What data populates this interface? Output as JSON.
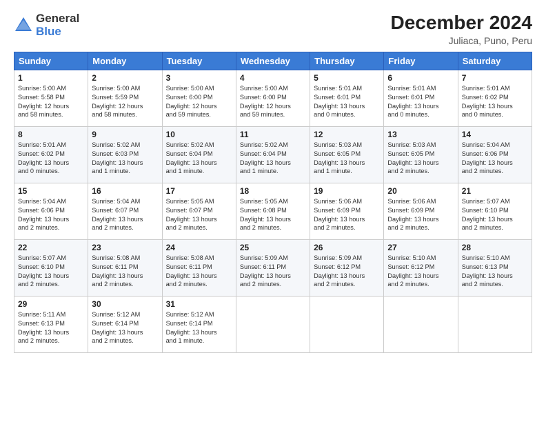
{
  "logo": {
    "general": "General",
    "blue": "Blue"
  },
  "title": "December 2024",
  "location": "Juliaca, Puno, Peru",
  "days_of_week": [
    "Sunday",
    "Monday",
    "Tuesday",
    "Wednesday",
    "Thursday",
    "Friday",
    "Saturday"
  ],
  "weeks": [
    [
      {
        "day": "1",
        "info": "Sunrise: 5:00 AM\nSunset: 5:58 PM\nDaylight: 12 hours\nand 58 minutes."
      },
      {
        "day": "2",
        "info": "Sunrise: 5:00 AM\nSunset: 5:59 PM\nDaylight: 12 hours\nand 58 minutes."
      },
      {
        "day": "3",
        "info": "Sunrise: 5:00 AM\nSunset: 6:00 PM\nDaylight: 12 hours\nand 59 minutes."
      },
      {
        "day": "4",
        "info": "Sunrise: 5:00 AM\nSunset: 6:00 PM\nDaylight: 12 hours\nand 59 minutes."
      },
      {
        "day": "5",
        "info": "Sunrise: 5:01 AM\nSunset: 6:01 PM\nDaylight: 13 hours\nand 0 minutes."
      },
      {
        "day": "6",
        "info": "Sunrise: 5:01 AM\nSunset: 6:01 PM\nDaylight: 13 hours\nand 0 minutes."
      },
      {
        "day": "7",
        "info": "Sunrise: 5:01 AM\nSunset: 6:02 PM\nDaylight: 13 hours\nand 0 minutes."
      }
    ],
    [
      {
        "day": "8",
        "info": "Sunrise: 5:01 AM\nSunset: 6:02 PM\nDaylight: 13 hours\nand 0 minutes."
      },
      {
        "day": "9",
        "info": "Sunrise: 5:02 AM\nSunset: 6:03 PM\nDaylight: 13 hours\nand 1 minute."
      },
      {
        "day": "10",
        "info": "Sunrise: 5:02 AM\nSunset: 6:04 PM\nDaylight: 13 hours\nand 1 minute."
      },
      {
        "day": "11",
        "info": "Sunrise: 5:02 AM\nSunset: 6:04 PM\nDaylight: 13 hours\nand 1 minute."
      },
      {
        "day": "12",
        "info": "Sunrise: 5:03 AM\nSunset: 6:05 PM\nDaylight: 13 hours\nand 1 minute."
      },
      {
        "day": "13",
        "info": "Sunrise: 5:03 AM\nSunset: 6:05 PM\nDaylight: 13 hours\nand 2 minutes."
      },
      {
        "day": "14",
        "info": "Sunrise: 5:04 AM\nSunset: 6:06 PM\nDaylight: 13 hours\nand 2 minutes."
      }
    ],
    [
      {
        "day": "15",
        "info": "Sunrise: 5:04 AM\nSunset: 6:06 PM\nDaylight: 13 hours\nand 2 minutes."
      },
      {
        "day": "16",
        "info": "Sunrise: 5:04 AM\nSunset: 6:07 PM\nDaylight: 13 hours\nand 2 minutes."
      },
      {
        "day": "17",
        "info": "Sunrise: 5:05 AM\nSunset: 6:07 PM\nDaylight: 13 hours\nand 2 minutes."
      },
      {
        "day": "18",
        "info": "Sunrise: 5:05 AM\nSunset: 6:08 PM\nDaylight: 13 hours\nand 2 minutes."
      },
      {
        "day": "19",
        "info": "Sunrise: 5:06 AM\nSunset: 6:09 PM\nDaylight: 13 hours\nand 2 minutes."
      },
      {
        "day": "20",
        "info": "Sunrise: 5:06 AM\nSunset: 6:09 PM\nDaylight: 13 hours\nand 2 minutes."
      },
      {
        "day": "21",
        "info": "Sunrise: 5:07 AM\nSunset: 6:10 PM\nDaylight: 13 hours\nand 2 minutes."
      }
    ],
    [
      {
        "day": "22",
        "info": "Sunrise: 5:07 AM\nSunset: 6:10 PM\nDaylight: 13 hours\nand 2 minutes."
      },
      {
        "day": "23",
        "info": "Sunrise: 5:08 AM\nSunset: 6:11 PM\nDaylight: 13 hours\nand 2 minutes."
      },
      {
        "day": "24",
        "info": "Sunrise: 5:08 AM\nSunset: 6:11 PM\nDaylight: 13 hours\nand 2 minutes."
      },
      {
        "day": "25",
        "info": "Sunrise: 5:09 AM\nSunset: 6:11 PM\nDaylight: 13 hours\nand 2 minutes."
      },
      {
        "day": "26",
        "info": "Sunrise: 5:09 AM\nSunset: 6:12 PM\nDaylight: 13 hours\nand 2 minutes."
      },
      {
        "day": "27",
        "info": "Sunrise: 5:10 AM\nSunset: 6:12 PM\nDaylight: 13 hours\nand 2 minutes."
      },
      {
        "day": "28",
        "info": "Sunrise: 5:10 AM\nSunset: 6:13 PM\nDaylight: 13 hours\nand 2 minutes."
      }
    ],
    [
      {
        "day": "29",
        "info": "Sunrise: 5:11 AM\nSunset: 6:13 PM\nDaylight: 13 hours\nand 2 minutes."
      },
      {
        "day": "30",
        "info": "Sunrise: 5:12 AM\nSunset: 6:14 PM\nDaylight: 13 hours\nand 2 minutes."
      },
      {
        "day": "31",
        "info": "Sunrise: 5:12 AM\nSunset: 6:14 PM\nDaylight: 13 hours\nand 1 minute."
      },
      null,
      null,
      null,
      null
    ]
  ]
}
